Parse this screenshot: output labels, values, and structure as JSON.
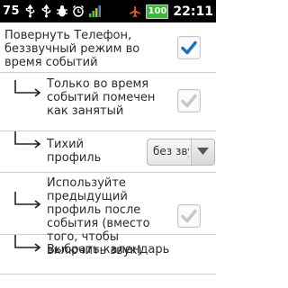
{
  "status_bar": {
    "notification_count": "75",
    "time": "22:11",
    "battery_percent": "100",
    "icons": [
      "usb-icon",
      "usb-icon",
      "bug-icon",
      "alarm-icon",
      "signal-bars-icon",
      "airplane-icon",
      "battery-icon"
    ]
  },
  "settings": [
    {
      "label": "Повернуть Телефон, беззвучный режим во время событий",
      "checked": true,
      "enabled": true
    },
    {
      "label": "Только во время событий помечен как занятый",
      "checked": true,
      "enabled": false
    },
    {
      "label": "Тихий профиль",
      "spinner_value": "без звука"
    },
    {
      "label": "Используйте предыдущий профиль после события (вместо того, чтобы включить звук)",
      "checked": true,
      "enabled": false
    },
    {
      "label": "Выбрать календарь"
    }
  ],
  "colors": {
    "accent": "#1a73c2",
    "disabled_check": "#c7c7c7",
    "battery": "#2fbf2f",
    "airplane": "#f05a24"
  }
}
